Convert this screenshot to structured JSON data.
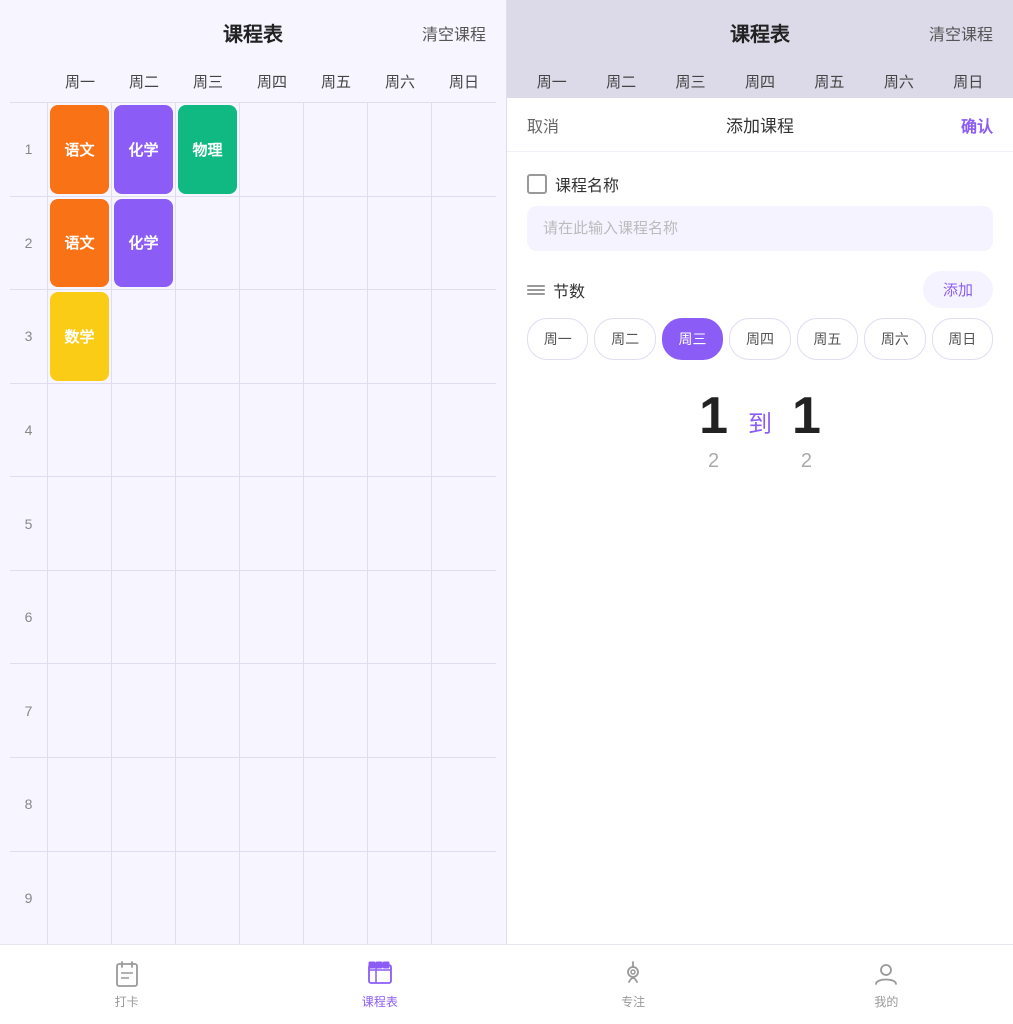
{
  "leftPanel": {
    "title": "课程表",
    "clearLabel": "清空课程",
    "days": [
      "周一",
      "周二",
      "周三",
      "周四",
      "周五",
      "周六",
      "周日"
    ],
    "rows": [
      1,
      2,
      3,
      4,
      5,
      6,
      7,
      8,
      9
    ],
    "courses": [
      {
        "row": 1,
        "col": 1,
        "label": "语文",
        "color": "#f97316"
      },
      {
        "row": 1,
        "col": 2,
        "label": "化学",
        "color": "#8b5cf6"
      },
      {
        "row": 1,
        "col": 3,
        "label": "物理",
        "color": "#10b981"
      },
      {
        "row": 2,
        "col": 1,
        "label": "语文",
        "color": "#f97316"
      },
      {
        "row": 2,
        "col": 2,
        "label": "化学",
        "color": "#8b5cf6"
      },
      {
        "row": 3,
        "col": 1,
        "label": "数学",
        "color": "#facc15"
      }
    ]
  },
  "rightPanel": {
    "title": "课程表",
    "clearLabel": "清空课程",
    "days": [
      "周一",
      "周二",
      "周三",
      "周四",
      "周五",
      "周六",
      "周日"
    ]
  },
  "dialog": {
    "cancelLabel": "取消",
    "title": "添加课程",
    "confirmLabel": "确认",
    "courseNameLabel": "课程名称",
    "courseNamePlaceholder": "请在此输入课程名称",
    "sectionsLabel": "节数",
    "addLabel": "添加",
    "weekdays": [
      "周一",
      "周二",
      "周三",
      "周四",
      "周五",
      "周六",
      "周日"
    ],
    "activeWeekday": 2,
    "fromValue": "1",
    "fromSmall": "2",
    "toLabel": "到",
    "toValue": "1",
    "toSmall": "2"
  },
  "bottomNav": {
    "items": [
      {
        "label": "打卡",
        "icon": "checkin-icon",
        "active": false
      },
      {
        "label": "课程表",
        "icon": "schedule-icon",
        "active": true
      },
      {
        "label": "专注",
        "icon": "focus-icon",
        "active": false
      },
      {
        "label": "我的",
        "icon": "profile-icon",
        "active": false
      }
    ]
  }
}
